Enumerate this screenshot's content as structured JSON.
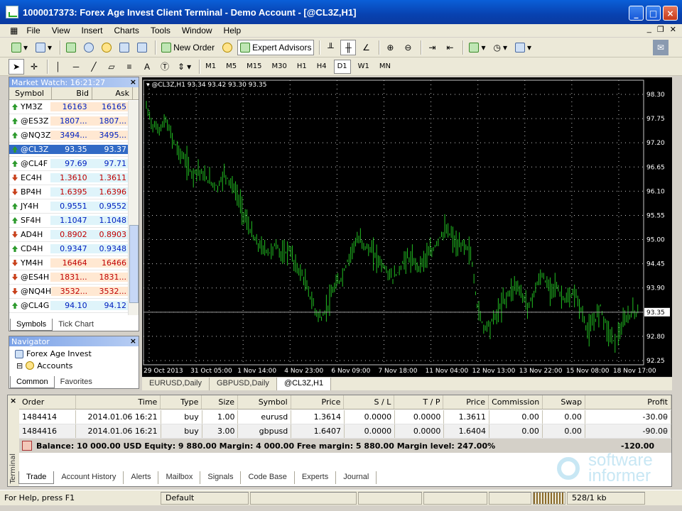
{
  "window": {
    "title": "1000017373: Forex Age Invest Client Terminal - Demo Account - [@CL3Z,H1]",
    "min": "_",
    "max": "□",
    "close": "×"
  },
  "menu": [
    "File",
    "View",
    "Insert",
    "Charts",
    "Tools",
    "Window",
    "Help"
  ],
  "toolbar": {
    "new_order": "New Order",
    "expert_advisors": "Expert Advisors",
    "timeframes": [
      "M1",
      "M5",
      "M15",
      "M30",
      "H1",
      "H4",
      "D1",
      "W1",
      "MN"
    ],
    "active_tf": "D1",
    "text_tool": "A"
  },
  "market_watch": {
    "title": "Market Watch: 16:21:27",
    "headers": [
      "Symbol",
      "Bid",
      "Ask"
    ],
    "rows": [
      {
        "sym": "YM3Z",
        "bid": "16163",
        "ask": "16165",
        "dir": "up",
        "bg": "#ffe8d2"
      },
      {
        "sym": "@ES3Z",
        "bid": "1807...",
        "ask": "1807...",
        "dir": "up",
        "bg": "#ffe8d2"
      },
      {
        "sym": "@NQ3Z",
        "bid": "3494...",
        "ask": "3495...",
        "dir": "up",
        "bg": "#ffe8d2"
      },
      {
        "sym": "@CL3Z",
        "bid": "93.35",
        "ask": "93.37",
        "dir": "up",
        "bg": "#316ac5",
        "sel": true
      },
      {
        "sym": "@CL4F",
        "bid": "97.69",
        "ask": "97.71",
        "dir": "up",
        "bg": "#dff4fa"
      },
      {
        "sym": "EC4H",
        "bid": "1.3610",
        "ask": "1.3611",
        "dir": "dn",
        "bg": "#dff4fa"
      },
      {
        "sym": "BP4H",
        "bid": "1.6395",
        "ask": "1.6396",
        "dir": "dn",
        "bg": "#dff4fa"
      },
      {
        "sym": "JY4H",
        "bid": "0.9551",
        "ask": "0.9552",
        "dir": "up",
        "bg": "#dff4fa"
      },
      {
        "sym": "SF4H",
        "bid": "1.1047",
        "ask": "1.1048",
        "dir": "up",
        "bg": "#dff4fa"
      },
      {
        "sym": "AD4H",
        "bid": "0.8902",
        "ask": "0.8903",
        "dir": "dn",
        "bg": "#dff4fa"
      },
      {
        "sym": "CD4H",
        "bid": "0.9347",
        "ask": "0.9348",
        "dir": "up",
        "bg": "#dff4fa"
      },
      {
        "sym": "YM4H",
        "bid": "16464",
        "ask": "16466",
        "dir": "dn",
        "bg": "#ffe8d2"
      },
      {
        "sym": "@ES4H",
        "bid": "1831...",
        "ask": "1831...",
        "dir": "dn",
        "bg": "#ffe8d2"
      },
      {
        "sym": "@NQ4H",
        "bid": "3532...",
        "ask": "3532...",
        "dir": "dn",
        "bg": "#ffe8d2"
      },
      {
        "sym": "@CL4G",
        "bid": "94.10",
        "ask": "94.12",
        "dir": "up",
        "bg": "#dff4fa"
      }
    ],
    "tabs": [
      "Symbols",
      "Tick Chart"
    ]
  },
  "navigator": {
    "title": "Navigator",
    "items": [
      "Forex Age Invest",
      "Accounts"
    ],
    "tabs": [
      "Common",
      "Favorites"
    ]
  },
  "chart_data": {
    "type": "line",
    "label": "@CL3Z,H1  93.34 93.42 93.30 93.35",
    "y_ticks": [
      "98.30",
      "97.75",
      "97.20",
      "96.65",
      "96.10",
      "95.55",
      "95.00",
      "94.45",
      "93.90",
      "93.35",
      "92.80",
      "92.25"
    ],
    "x_ticks": [
      "29 Oct 2013",
      "31 Oct 05:00",
      "1 Nov 14:00",
      "4 Nov 23:00",
      "6 Nov 09:00",
      "7 Nov 18:00",
      "11 Nov 04:00",
      "12 Nov 13:00",
      "13 Nov 22:00",
      "15 Nov 08:00",
      "18 Nov 17:00"
    ],
    "ylim": [
      92.25,
      98.3
    ],
    "current_price": "93.35",
    "values": [
      98.0,
      97.6,
      97.5,
      97.7,
      97.3,
      97.0,
      96.8,
      96.5,
      96.6,
      96.4,
      96.3,
      96.2,
      96.5,
      96.3,
      96.0,
      95.6,
      95.2,
      94.9,
      94.8,
      94.7,
      94.9,
      94.6,
      94.8,
      94.4,
      94.2,
      93.8,
      93.4,
      93.2,
      93.5,
      93.9,
      94.1,
      94.5,
      94.9,
      95.0,
      94.8,
      94.7,
      94.5,
      94.3,
      94.1,
      94.3,
      94.6,
      94.5,
      94.4,
      94.6,
      94.7,
      95.0,
      95.2,
      95.1,
      94.8,
      94.9,
      94.7,
      93.5,
      93.0,
      93.1,
      93.3,
      93.6,
      93.8,
      94.0,
      93.7,
      93.5,
      93.9,
      94.2,
      93.9,
      94.0,
      93.7,
      93.6,
      93.8,
      93.4,
      92.9,
      93.1,
      93.5,
      93.0,
      92.7,
      92.9,
      93.2,
      93.35
    ],
    "grid": true
  },
  "chart_tabs": [
    "EURUSD,Daily",
    "GBPUSD,Daily",
    "@CL3Z,H1"
  ],
  "terminal": {
    "headers": [
      "Order",
      "Time",
      "Type",
      "Size",
      "Symbol",
      "Price",
      "S / L",
      "T / P",
      "Price",
      "Commission",
      "Swap",
      "Profit"
    ],
    "rows": [
      [
        "1484414",
        "2014.01.06 16:21",
        "buy",
        "1.00",
        "eurusd",
        "1.3614",
        "0.0000",
        "0.0000",
        "1.3611",
        "0.00",
        "0.00",
        "-30.00"
      ],
      [
        "1484416",
        "2014.01.06 16:21",
        "buy",
        "3.00",
        "gbpusd",
        "1.6407",
        "0.0000",
        "0.0000",
        "1.6404",
        "0.00",
        "0.00",
        "-90.00"
      ]
    ],
    "balance": "Balance: 10 000.00 USD  Equity: 9 880.00  Margin: 4 000.00  Free margin: 5 880.00  Margin level: 247.00%",
    "balance_profit": "-120.00",
    "side_label": "Terminal",
    "tabs": [
      "Trade",
      "Account History",
      "Alerts",
      "Mailbox",
      "Signals",
      "Code Base",
      "Experts",
      "Journal"
    ]
  },
  "status": {
    "help": "For Help, press F1",
    "profile": "Default",
    "traffic": "528/1 kb"
  },
  "watermark": {
    "line1": "software",
    "line2": "informer"
  }
}
